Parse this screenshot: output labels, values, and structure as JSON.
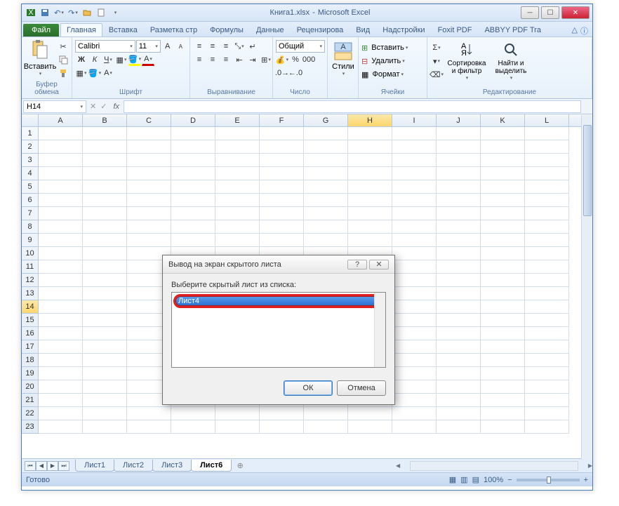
{
  "title": {
    "doc": "Книга1.xlsx",
    "app": "Microsoft Excel"
  },
  "tabs": {
    "file": "Файл",
    "list": [
      "Главная",
      "Вставка",
      "Разметка стр",
      "Формулы",
      "Данные",
      "Рецензирова",
      "Вид",
      "Надстройки",
      "Foxit PDF",
      "ABBYY PDF Tra"
    ],
    "active": 0
  },
  "ribbon": {
    "clipboard": {
      "paste": "Вставить",
      "label": "Буфер обмена"
    },
    "font": {
      "name": "Calibri",
      "size": "11",
      "label": "Шрифт"
    },
    "align": {
      "label": "Выравнивание"
    },
    "number": {
      "format": "Общий",
      "label": "Число"
    },
    "styles": {
      "btn": "Стили",
      "label": ""
    },
    "cells": {
      "insert": "Вставить",
      "delete": "Удалить",
      "format": "Формат",
      "label": "Ячейки"
    },
    "editing": {
      "sort": "Сортировка и фильтр",
      "find": "Найти и выделить",
      "label": "Редактирование"
    }
  },
  "namebox": "H14",
  "columns": [
    "A",
    "B",
    "C",
    "D",
    "E",
    "F",
    "G",
    "H",
    "I",
    "J",
    "K",
    "L"
  ],
  "rows": [
    "1",
    "2",
    "3",
    "4",
    "5",
    "6",
    "7",
    "8",
    "9",
    "10",
    "11",
    "12",
    "13",
    "14",
    "15",
    "16",
    "17",
    "18",
    "19",
    "20",
    "21",
    "22",
    "23"
  ],
  "active": {
    "col": 7,
    "row": 13
  },
  "sheets": {
    "tabs": [
      "Лист1",
      "Лист2",
      "Лист3",
      "Лист6"
    ],
    "active": 3
  },
  "status": {
    "ready": "Готово",
    "zoom": "100%"
  },
  "dialog": {
    "title": "Вывод на экран скрытого листа",
    "label": "Выберите скрытый лист из списка:",
    "item": "Лист4",
    "ok": "ОК",
    "cancel": "Отмена",
    "help": "?",
    "close": "✕"
  }
}
